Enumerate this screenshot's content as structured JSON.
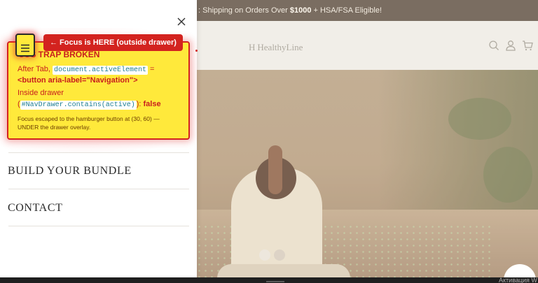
{
  "announcement": {
    "partial_prefix": ": Shipping on Orders Over ",
    "amount": "$1000",
    "suffix": " + HSA/FSA Eligible!"
  },
  "header": {
    "logo_text": "HealthyLine",
    "logo_mark": "H",
    "icons": [
      "search-icon",
      "account-icon",
      "cart-icon"
    ]
  },
  "hero": {
    "slide_count": 2,
    "active_slide": 1
  },
  "drawer": {
    "aria_label": "Navigation",
    "close_icon": "close-icon",
    "nav_items": [
      {
        "label": "BUILD YOUR BUNDLE"
      },
      {
        "label": "CONTACT"
      }
    ]
  },
  "debug": {
    "callout": "← Focus is HERE (outside drawer)",
    "title_visible": "CUS TRAP BROKEN",
    "line1_prefix": "After Tab, ",
    "line1_code": "document.activeElement",
    "line1_suffix": " =",
    "line2": "<button aria-label=\"Navigation\">",
    "line3": "Inside drawer",
    "line4_open": "(",
    "line4_code": "#NavDrawer.contains(active)",
    "line4_close": "): ",
    "line4_value": "false",
    "note_line1": "Focus escaped to the hamburger button at (30, 60) —",
    "note_line2": "UNDER the drawer overlay.",
    "colors": {
      "panel": "#ffe93b",
      "accent": "#d3231f",
      "code": "#1d7d93"
    }
  },
  "system": {
    "watermark": "Активация W"
  }
}
